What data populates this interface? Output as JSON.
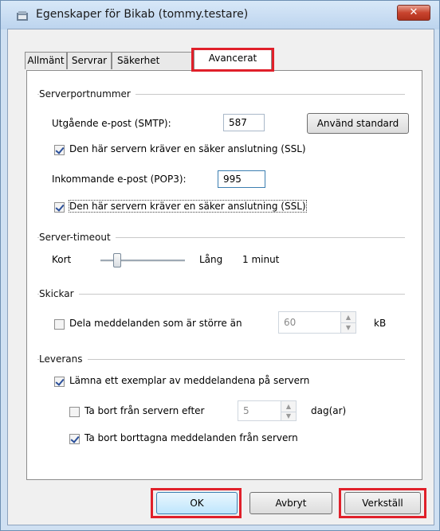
{
  "window": {
    "title": "Egenskaper för Bikab (tommy.testare)",
    "close_label": "✕"
  },
  "tabs": [
    {
      "label": "Allmänt"
    },
    {
      "label": "Servrar"
    },
    {
      "label": "Säkerhet"
    },
    {
      "label": "Avancerat",
      "active": true
    }
  ],
  "server_ports": {
    "group_label": "Serverportnummer",
    "smtp_label": "Utgående e-post (SMTP):",
    "smtp_value": "587",
    "default_button": "Använd standard",
    "smtp_ssl_label": "Den här servern kräver en säker anslutning (SSL)",
    "smtp_ssl_checked": true,
    "pop3_label": "Inkommande e-post (POP3):",
    "pop3_value": "995",
    "pop3_ssl_label": "Den här servern kräver en säker anslutning (SSL)",
    "pop3_ssl_checked": true
  },
  "timeout": {
    "group_label": "Server-timeout",
    "short_label": "Kort",
    "long_label": "Lång",
    "value_label": "1 minut",
    "slider_level": 0.2
  },
  "sending": {
    "group_label": "Skickar",
    "split_label": "Dela meddelanden som är större än",
    "split_checked": false,
    "split_value": "60",
    "unit": "kB"
  },
  "delivery": {
    "group_label": "Leverans",
    "leave_copy_label": "Lämna ett exemplar av meddelandena på servern",
    "leave_copy_checked": true,
    "remove_after_label": "Ta bort från servern efter",
    "remove_after_checked": false,
    "remove_after_value": "5",
    "days_unit": "dag(ar)",
    "remove_deleted_label": "Ta bort borttagna meddelanden från servern",
    "remove_deleted_checked": true
  },
  "buttons": {
    "ok": "OK",
    "cancel": "Avbryt",
    "apply": "Verkställ"
  },
  "colors": {
    "highlight": "#e0202a",
    "close_button": "#c8442e"
  }
}
